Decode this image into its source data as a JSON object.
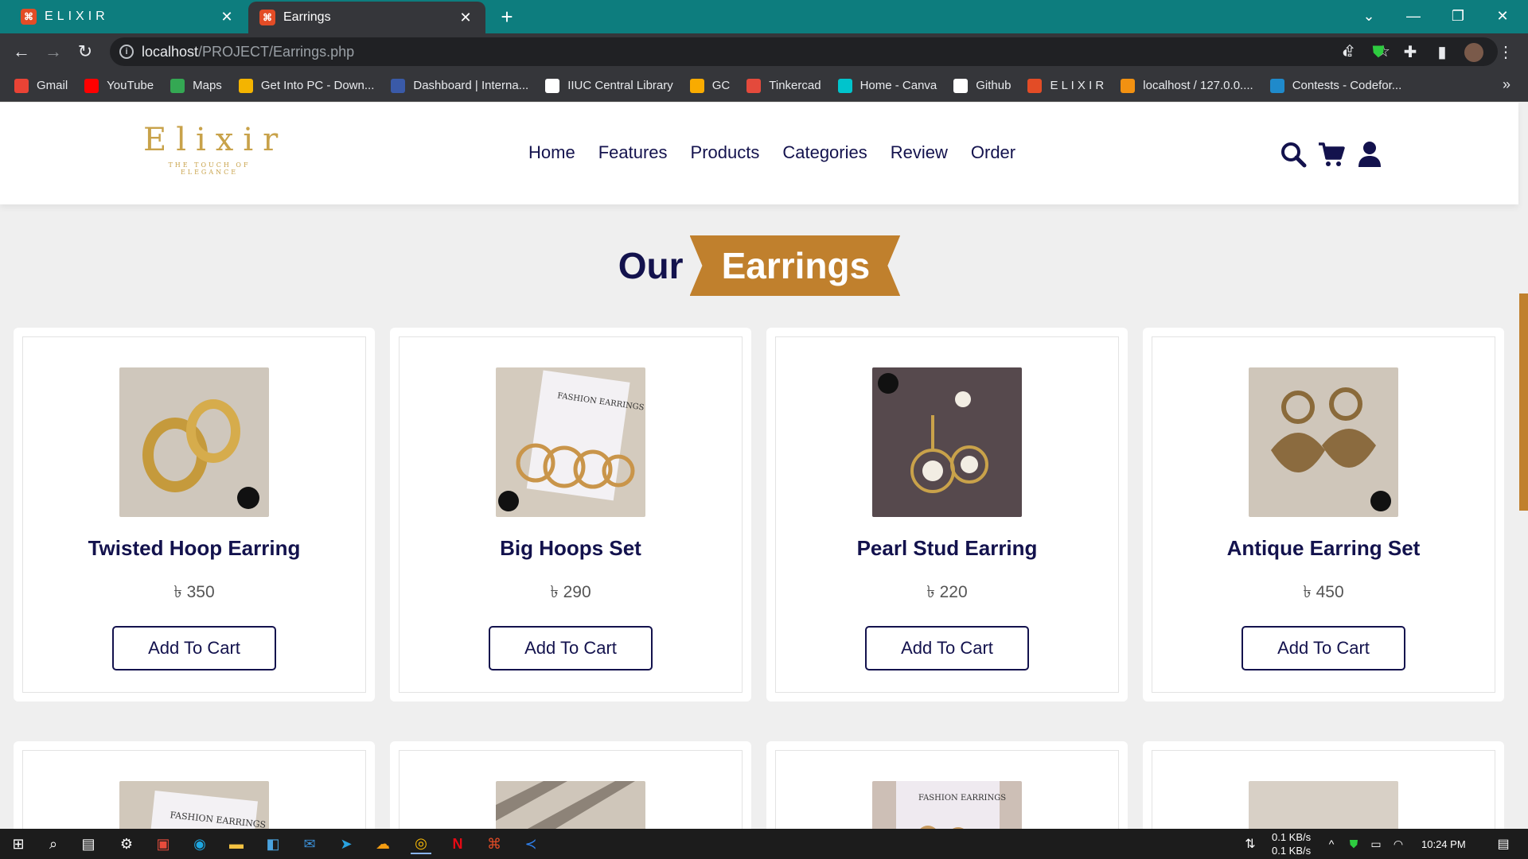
{
  "browser": {
    "tabs": [
      {
        "title": "ELIXIR",
        "active": false
      },
      {
        "title": "Earrings",
        "active": true
      }
    ],
    "url_host": "localhost",
    "url_path": "/PROJECT/Earrings.php",
    "bookmarks": [
      {
        "label": "Gmail",
        "icon": "gmail-icon",
        "color": "#ea4335"
      },
      {
        "label": "YouTube",
        "icon": "youtube-icon",
        "color": "#ff0000"
      },
      {
        "label": "Maps",
        "icon": "maps-icon",
        "color": "#34a853"
      },
      {
        "label": "Get Into PC - Down...",
        "icon": "getintopc-icon",
        "color": "#f4b400"
      },
      {
        "label": "Dashboard | Interna...",
        "icon": "dashboard-icon",
        "color": "#3a5aa8"
      },
      {
        "label": "IIUC Central Library",
        "icon": "library-icon",
        "color": "#ffffff"
      },
      {
        "label": "GC",
        "icon": "classroom-icon",
        "color": "#f9ab00"
      },
      {
        "label": "Tinkercad",
        "icon": "tinkercad-icon",
        "color": "#e44a3c"
      },
      {
        "label": "Home - Canva",
        "icon": "canva-icon",
        "color": "#00c4cc"
      },
      {
        "label": "Github",
        "icon": "github-icon",
        "color": "#ffffff"
      },
      {
        "label": "E L I X I R",
        "icon": "elixir-icon",
        "color": "#e34c26"
      },
      {
        "label": "localhost / 127.0.0....",
        "icon": "phpmyadmin-icon",
        "color": "#f29111"
      },
      {
        "label": "Contests - Codefor...",
        "icon": "codeforces-icon",
        "color": "#1f8acb"
      }
    ]
  },
  "site": {
    "logo_text": "Elixir",
    "logo_tagline": "THE TOUCH OF ELEGANCE",
    "nav": [
      "Home",
      "Features",
      "Products",
      "Categories",
      "Review",
      "Order"
    ],
    "heading_first": "Our",
    "heading_highlight": "Earrings",
    "accent_color": "#c0802d",
    "text_color": "#13124d"
  },
  "products": [
    {
      "name": "Twisted Hoop Earring",
      "price": "৳ 350",
      "button": "Add To Cart"
    },
    {
      "name": "Big Hoops Set",
      "price": "৳ 290",
      "button": "Add To Cart"
    },
    {
      "name": "Pearl Stud Earring",
      "price": "৳ 220",
      "button": "Add To Cart"
    },
    {
      "name": "Antique Earring Set",
      "price": "৳ 450",
      "button": "Add To Cart"
    }
  ],
  "taskbar": {
    "net_down": "0.1 KB/s",
    "net_up": "0.1 KB/s",
    "time": "10:24 PM"
  }
}
